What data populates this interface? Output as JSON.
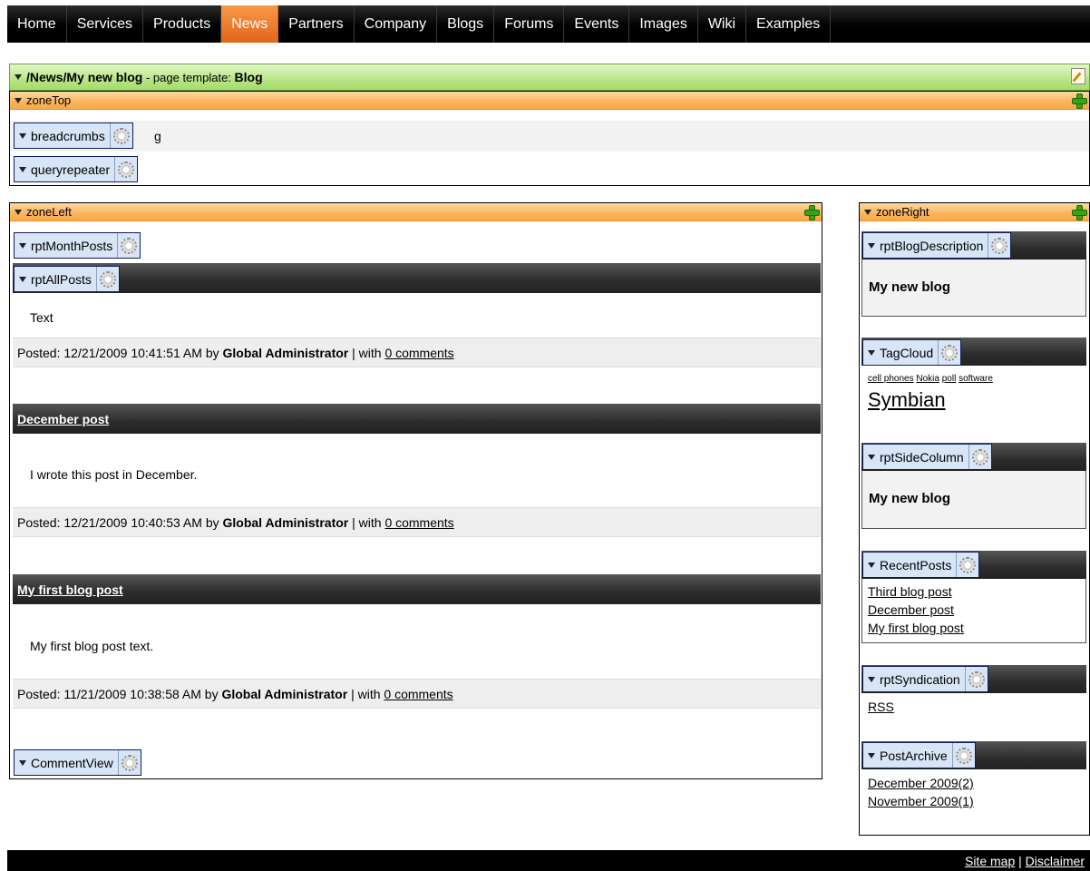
{
  "nav": [
    "Home",
    "Services",
    "Products",
    "News",
    "Partners",
    "Company",
    "Blogs",
    "Forums",
    "Events",
    "Images",
    "Wiki",
    "Examples"
  ],
  "nav_active": "News",
  "page_header": {
    "path": "/News/My new blog",
    "mid": " - page template: ",
    "template": "Blog"
  },
  "zone_top": {
    "title": "zoneTop",
    "wp1": "breadcrumbs",
    "wp1_tail": "g",
    "wp2": "queryrepeater"
  },
  "zone_left": {
    "title": "zoneLeft",
    "wp_month": "rptMonthPosts",
    "wp_all": "rptAllPosts",
    "posts": [
      {
        "title": "",
        "text": "Text",
        "posted": "Posted: 12/21/2009 10:41:51 AM by ",
        "author": "Global Administrator",
        "sep": " | with ",
        "comments": "0 comments"
      },
      {
        "title": "December post",
        "text": "I wrote this post in December.",
        "posted": "Posted: 12/21/2009 10:40:53 AM by ",
        "author": "Global Administrator",
        "sep": " | with ",
        "comments": "0 comments"
      },
      {
        "title": "My first blog post",
        "text": "My first blog post text.",
        "posted": "Posted: 11/21/2009 10:38:58 AM by ",
        "author": "Global Administrator",
        "sep": " | with ",
        "comments": "0 comments"
      }
    ],
    "wp_comments": "CommentView"
  },
  "zone_right": {
    "title": "zoneRight",
    "blog_desc_wp": "rptBlogDescription",
    "blog_desc": "My new blog",
    "tagcloud_wp": "TagCloud",
    "tags_small": [
      "cell phones",
      "Nokia",
      "poll",
      "software"
    ],
    "tag_big": "Symbian",
    "side_wp": "rptSideColumn",
    "side_text": "My new blog",
    "recent_wp": "RecentPosts",
    "recent": [
      "Third blog post",
      "December post",
      "My first blog post"
    ],
    "synd_wp": "rptSyndication",
    "synd": "RSS",
    "archive_wp": "PostArchive",
    "archive": [
      "December 2009(2)",
      "November 2009(1)"
    ]
  },
  "footer": {
    "sitemap": "Site map",
    "sep": " | ",
    "disclaimer": "Disclaimer"
  }
}
